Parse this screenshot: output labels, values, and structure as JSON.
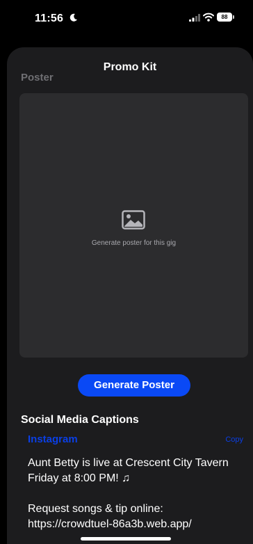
{
  "status_bar": {
    "time": "11:56",
    "battery": "88"
  },
  "sheet": {
    "title": "Promo Kit"
  },
  "poster": {
    "section_label": "Poster",
    "placeholder_text": "Generate poster for this gig",
    "generate_button_label": "Generate Poster"
  },
  "captions": {
    "heading": "Social Media Captions",
    "items": [
      {
        "platform": "Instagram",
        "copy_label": "Copy",
        "line1": "Aunt Betty is live at Crescent City Tavern Friday at 8:00 PM! ♫",
        "line2": "Request songs & tip online:",
        "line3": "https://crowdtuel-86a3b.web.app/"
      }
    ]
  },
  "colors": {
    "accent": "#0a49f5",
    "sheet_bg": "#1c1c1e",
    "poster_bg": "#2c2c2e"
  }
}
